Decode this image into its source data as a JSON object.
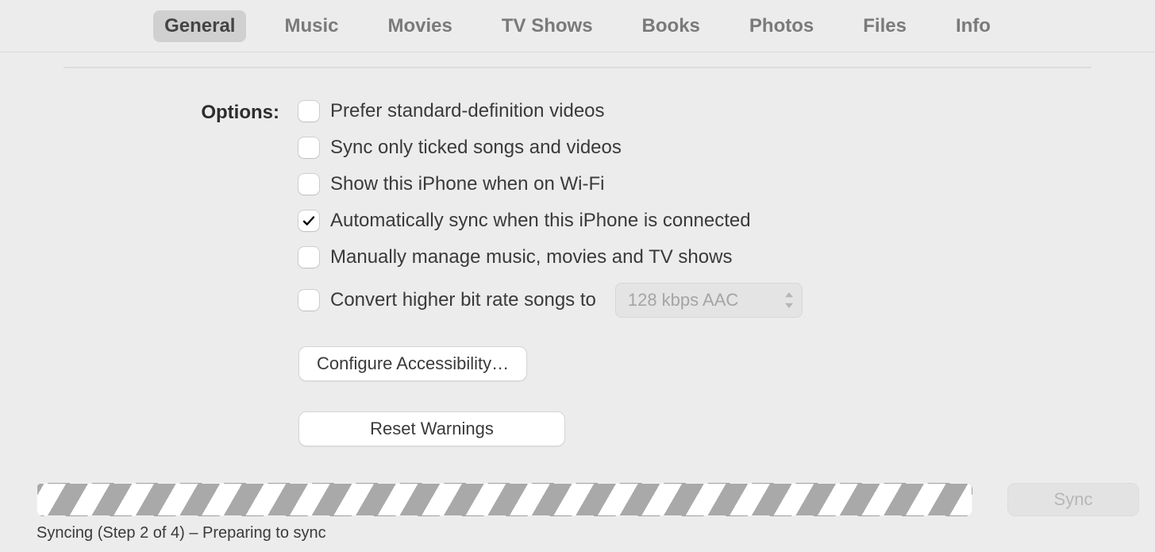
{
  "tabs": {
    "general": "General",
    "music": "Music",
    "movies": "Movies",
    "tvshows": "TV Shows",
    "books": "Books",
    "photos": "Photos",
    "files": "Files",
    "info": "Info",
    "active": "general"
  },
  "options": {
    "label": "Options:",
    "prefer_sd": {
      "label": "Prefer standard-definition videos",
      "checked": false
    },
    "sync_ticked": {
      "label": "Sync only ticked songs and videos",
      "checked": false
    },
    "show_on_wifi": {
      "label": "Show this iPhone when on Wi-Fi",
      "checked": false
    },
    "auto_sync": {
      "label": "Automatically sync when this iPhone is connected",
      "checked": true
    },
    "manual_manage": {
      "label": "Manually manage music, movies and TV shows",
      "checked": false
    },
    "convert_bitrate": {
      "label": "Convert higher bit rate songs to",
      "checked": false,
      "select_value": "128 kbps AAC"
    }
  },
  "buttons": {
    "configure_accessibility": "Configure Accessibility…",
    "reset_warnings": "Reset Warnings",
    "sync": "Sync"
  },
  "status": "Syncing (Step 2 of 4) – Preparing to sync"
}
